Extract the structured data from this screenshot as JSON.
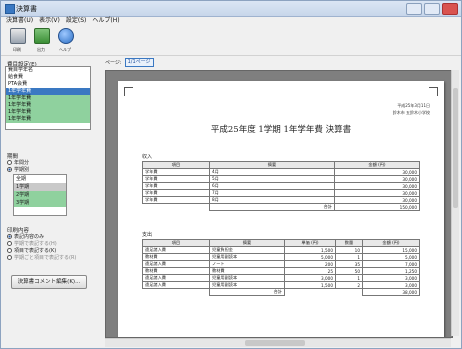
{
  "window": {
    "title": "決算書"
  },
  "menu": [
    {
      "label": "決算書(U)"
    },
    {
      "label": "表示(V)"
    },
    {
      "label": "設定(S)"
    },
    {
      "label": "ヘルプ(H)"
    }
  ],
  "toolbar": [
    {
      "label": "印刷",
      "icon": "printer-icon"
    },
    {
      "label": "出力",
      "icon": "export-icon"
    },
    {
      "label": "ヘルプ",
      "icon": "help-icon"
    }
  ],
  "left": {
    "list_label": "費目設定(E)",
    "list_items": [
      {
        "label": "費目学年名",
        "style": "plain"
      },
      {
        "label": "給食費",
        "style": "plain"
      },
      {
        "label": "PTA会費",
        "style": "plain"
      },
      {
        "label": "1年学年費",
        "style": "selected"
      },
      {
        "label": "1年学年費",
        "style": "green"
      },
      {
        "label": "1年学年費",
        "style": "green"
      },
      {
        "label": "1年学年費",
        "style": "green"
      },
      {
        "label": "1年学年費",
        "style": "green"
      }
    ],
    "period_label": "期間",
    "period_options": [
      {
        "label": "年間分",
        "selected": false
      },
      {
        "label": "学期別",
        "selected": true
      }
    ],
    "term_items": [
      {
        "label": "全期",
        "style": "plain"
      },
      {
        "label": "1学期",
        "style": "gray"
      },
      {
        "label": "2学期",
        "style": "green"
      },
      {
        "label": "3学期",
        "style": "green"
      }
    ],
    "print_label": "印刷内容",
    "print_options": [
      {
        "label": "表記内容のみ",
        "selected": true
      },
      {
        "label": "学期で表記する(H)",
        "selected": false
      },
      {
        "label": "項目で表記する(K)",
        "selected": false
      },
      {
        "label": "学期ごと項目で表記する(R)",
        "selected": false
      }
    ],
    "edit_button": "決算書コメント編集(K)..."
  },
  "preview": {
    "page_label": "ページ:",
    "page_value": "1/1ページ",
    "doc": {
      "date": "平成25年3月11日",
      "school": "鈴木市 五鈴木小学校",
      "title": "平成25年度 1学期 1年学年費 決算書",
      "income_label": "収入",
      "income_headers": [
        "項目",
        "摘要",
        "金額 (円)"
      ],
      "income_rows": [
        [
          "学年費",
          "4月",
          "30,000"
        ],
        [
          "学年費",
          "5月",
          "30,000"
        ],
        [
          "学年費",
          "6月",
          "30,000"
        ],
        [
          "学年費",
          "7月",
          "30,000"
        ],
        [
          "学年費",
          "8月",
          "30,000"
        ]
      ],
      "income_total_label": "合計",
      "income_total": "150,000",
      "expense_label": "支出",
      "expense_headers": [
        "項目",
        "摘要",
        "単価 (円)",
        "数量",
        "金額 (円)"
      ],
      "expense_rows": [
        [
          "遠足諸入費",
          "児童負担金",
          "1,500",
          "10",
          "15,000"
        ],
        [
          "教材費",
          "児童用副読本",
          "5,000",
          "1",
          "5,000"
        ],
        [
          "遠足諸入費",
          "ノート",
          "200",
          "35",
          "7,000"
        ],
        [
          "教材費",
          "教材費",
          "25",
          "50",
          "1,250"
        ],
        [
          "遠足諸入費",
          "児童用副読本",
          "3,000",
          "1",
          "3,000"
        ],
        [
          "遠足諸入費",
          "児童用副読本",
          "1,500",
          "2",
          "3,000"
        ]
      ],
      "expense_total_label": "合計",
      "expense_total": "38,000"
    }
  }
}
